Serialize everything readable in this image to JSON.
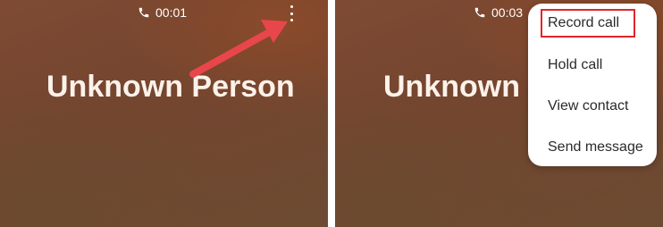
{
  "left_screen": {
    "status": {
      "call_timer": "00:01",
      "icon": "phone-icon"
    },
    "more_icon": "more-vert-icon",
    "caller_name": "Unknown Person",
    "annotation": {
      "type": "arrow",
      "color": "#e8464a"
    }
  },
  "right_screen": {
    "status": {
      "call_timer": "00:03",
      "icon": "phone-icon"
    },
    "caller_name": "Unknown Person",
    "menu": {
      "items": [
        {
          "label": "Record call",
          "highlighted": true
        },
        {
          "label": "Hold call"
        },
        {
          "label": "View contact"
        },
        {
          "label": "Send message"
        }
      ]
    },
    "highlight_color": "#e0262b"
  },
  "colors": {
    "background_brown": "#7a4a32",
    "text_white": "#ffffff",
    "menu_background": "#ffffff",
    "menu_text": "#2a2a2a"
  }
}
